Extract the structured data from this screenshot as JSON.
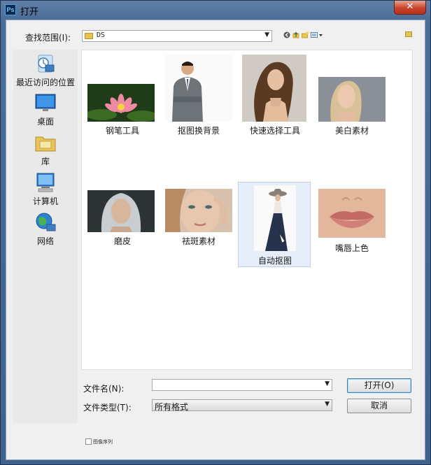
{
  "window": {
    "title": "打开",
    "app_icon": "Ps",
    "close_glyph": "✕"
  },
  "lookin": {
    "label": "查找范围(I):",
    "value": "DS"
  },
  "toolbar": {
    "icons": [
      "back-icon",
      "up-folder-icon",
      "new-folder-icon",
      "view-menu-icon"
    ]
  },
  "places": [
    {
      "id": "recent",
      "label": "最近访问的位置"
    },
    {
      "id": "desktop",
      "label": "桌面"
    },
    {
      "id": "library",
      "label": "库"
    },
    {
      "id": "computer",
      "label": "计算机"
    },
    {
      "id": "network",
      "label": "网络"
    }
  ],
  "files": [
    {
      "id": "pen-tool",
      "label": "钢笔工具"
    },
    {
      "id": "cutout-background",
      "label": "抠图换背景"
    },
    {
      "id": "quick-select",
      "label": "快速选择工具"
    },
    {
      "id": "whitening",
      "label": "美白素材"
    },
    {
      "id": "skin-smoothing",
      "label": "磨皮"
    },
    {
      "id": "freckle-removal",
      "label": "祛斑素材"
    },
    {
      "id": "auto-cutout",
      "label": "自动抠图"
    },
    {
      "id": "lip-color",
      "label": "嘴唇上色"
    }
  ],
  "selected_file": "自动抠图",
  "filename": {
    "label": "文件名(N):",
    "value": ""
  },
  "filetype": {
    "label": "文件类型(T):",
    "value": "所有格式"
  },
  "buttons": {
    "open": "打开(O)",
    "cancel": "取消"
  },
  "image_sequence": {
    "label": "图像序列",
    "checked": false
  }
}
